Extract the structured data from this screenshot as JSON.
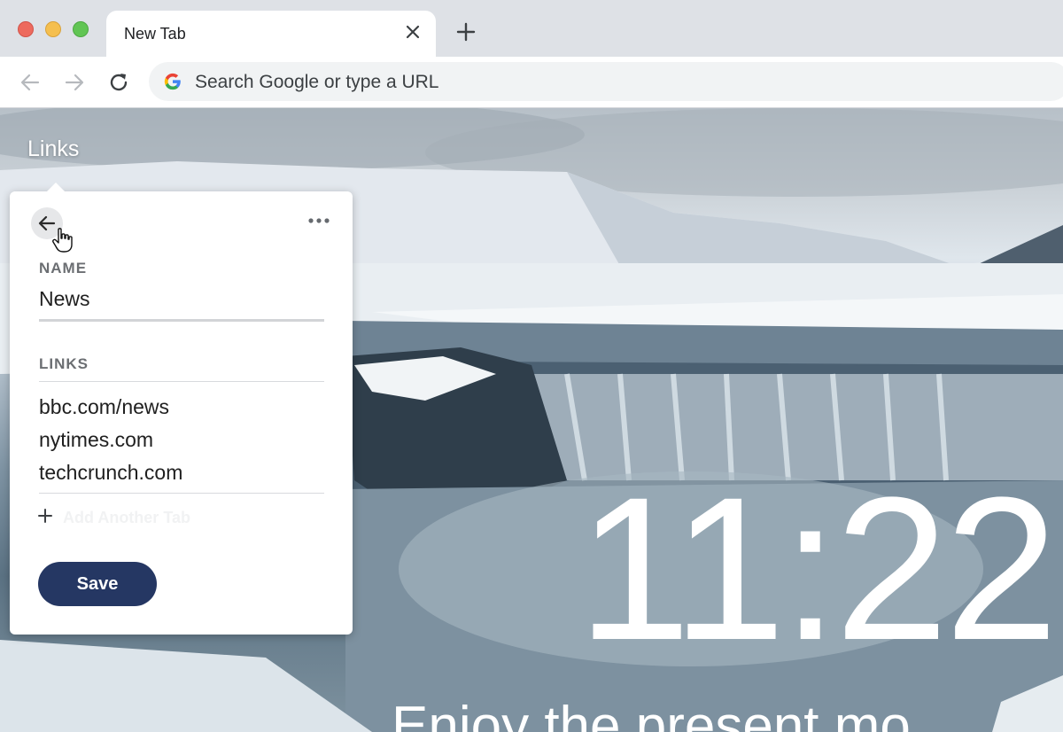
{
  "window": {
    "tab_title": "New Tab"
  },
  "toolbar": {
    "omnibox_placeholder": "Search Google or type a URL"
  },
  "page": {
    "links_heading": "Links",
    "clock": "11:22",
    "quote": "Enjoy the present mo"
  },
  "panel": {
    "name_label": "NAME",
    "name_value": "News",
    "links_label": "LINKS",
    "links": [
      "bbc.com/news",
      "nytimes.com",
      "techcrunch.com"
    ],
    "add_tab_label": "Add Another Tab",
    "save_label": "Save"
  },
  "colors": {
    "save_button": "#253763",
    "tab_strip": "#dee1e6",
    "omnibox": "#f1f3f4"
  },
  "icons": [
    "close-icon",
    "plus-icon",
    "back-arrow-icon",
    "forward-arrow-icon",
    "reload-icon",
    "google-g-icon",
    "more-horizontal-icon",
    "hand-cursor-icon"
  ]
}
